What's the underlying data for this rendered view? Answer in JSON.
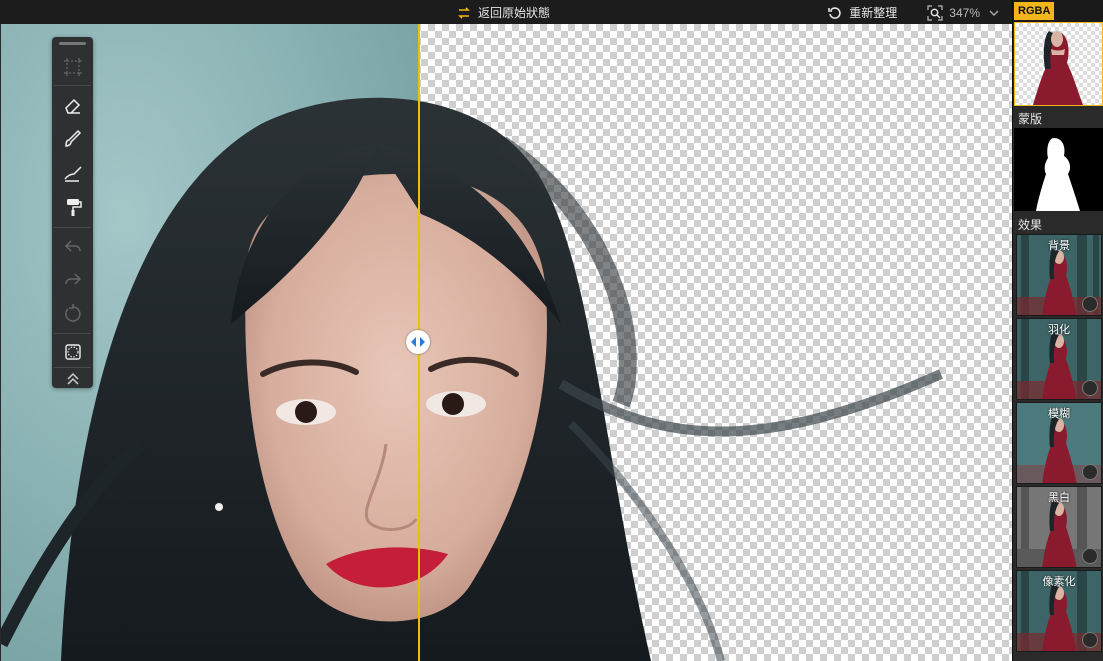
{
  "topbar": {
    "revert_label": "返回原始狀態",
    "rearrange_label": "重新整理",
    "zoom_value": "347%"
  },
  "right_panel": {
    "tab_label": "RGBA",
    "mask_label": "蒙版",
    "effects_label": "效果",
    "effects": [
      {
        "label": "背景"
      },
      {
        "label": "羽化"
      },
      {
        "label": "模糊"
      },
      {
        "label": "黑白"
      },
      {
        "label": "像素化"
      }
    ]
  },
  "colors": {
    "accent": "#f2b51c",
    "divider": "#e6c200",
    "dress": "#8a1a2e"
  },
  "icons": [
    "swap-arrows-icon",
    "refresh-icon",
    "zoom-icon",
    "chevron-down-icon",
    "crop-icon",
    "eraser-icon",
    "brush-icon",
    "paint-brush-icon",
    "roller-icon",
    "undo-icon",
    "redo-icon",
    "reset-icon",
    "selection-icon",
    "collapse-icon",
    "split-handle-icon"
  ]
}
